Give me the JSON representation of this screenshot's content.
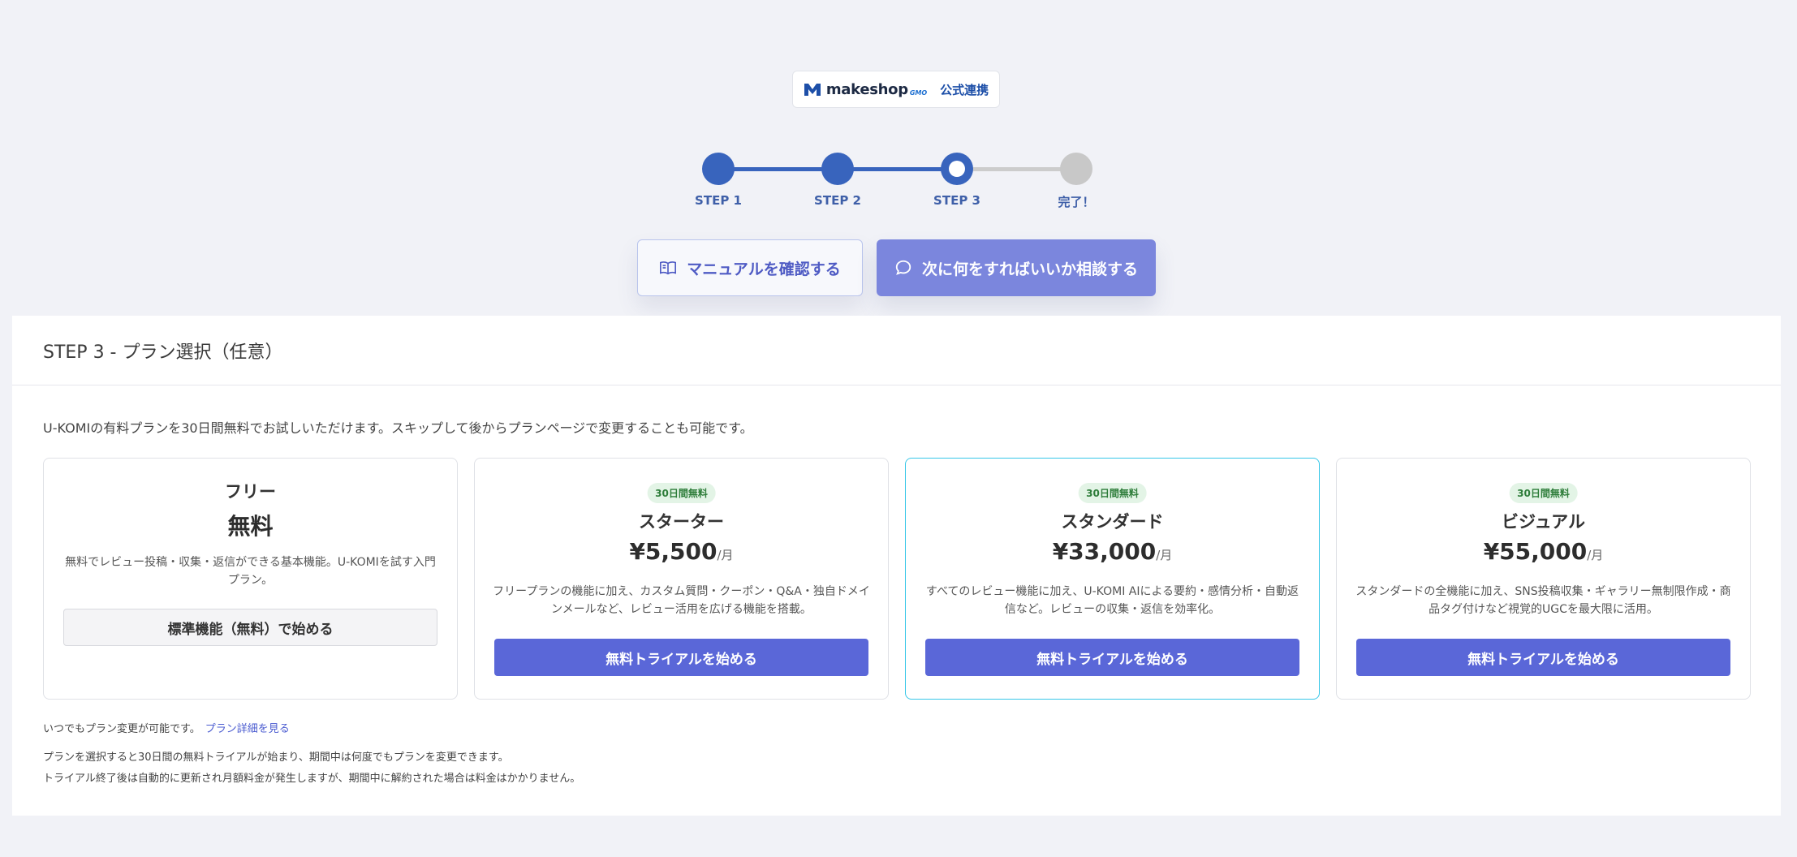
{
  "header": {
    "logo_text": "makeshop",
    "logo_suffix": "GMO",
    "official": "公式連携"
  },
  "stepper": {
    "steps": [
      {
        "label": "STEP 1",
        "state": "done"
      },
      {
        "label": "STEP 2",
        "state": "done"
      },
      {
        "label": "STEP 3",
        "state": "current"
      },
      {
        "label": "完了！",
        "state": "todo"
      }
    ]
  },
  "actions": {
    "manual_label": "マニュアルを確認する",
    "consult_label": "次に何をすればいいか相談する"
  },
  "card": {
    "title": "STEP 3 - プラン選択（任意）",
    "intro": "U-KOMIの有料プランを30日間無料でお試しいただけます。スキップして後からプランページで変更することも可能です。",
    "plans": [
      {
        "name": "フリー",
        "badge": "",
        "price": "無料",
        "unit": "",
        "desc": "無料でレビュー投稿・収集・返信ができる基本機能。U-KOMIを試す入門プラン。",
        "button": "標準機能（無料）で始める"
      },
      {
        "name": "スターター",
        "badge": "30日間無料",
        "price": "¥5,500",
        "unit": "/月",
        "desc": "フリープランの機能に加え、カスタム質問・クーポン・Q&A・独自ドメインメールなど、レビュー活用を広げる機能を搭載。",
        "button": "無料トライアルを始める"
      },
      {
        "name": "スタンダード",
        "badge": "30日間無料",
        "price": "¥33,000",
        "unit": "/月",
        "desc": "すべてのレビュー機能に加え、U-KOMI AIによる要約・感情分析・自動返信など。レビューの収集・返信を効率化。",
        "button": "無料トライアルを始める"
      },
      {
        "name": "ビジュアル",
        "badge": "30日間無料",
        "price": "¥55,000",
        "unit": "/月",
        "desc": "スタンダードの全機能に加え、SNS投稿収集・ギャラリー無制限作成・商品タグ付けなど視覚的UGCを最大限に活用。",
        "button": "無料トライアルを始める"
      }
    ],
    "note": "いつでもプラン変更が可能です。",
    "note_link": "プラン詳細を見る",
    "footnote1": "プランを選択すると30日間の無料トライアルが始まり、期間中は何度でもプランを変更できます。",
    "footnote2": "トライアル終了後は自動的に更新され月額料金が発生しますが、期間中に解約された場合は料金はかかりません。"
  },
  "colors": {
    "accent": "#3864bd",
    "primary_button": "#5a67d8",
    "consult_button": "#7b86dd",
    "highlight_border": "#37c7e8",
    "badge_bg": "#e3f4e6"
  }
}
